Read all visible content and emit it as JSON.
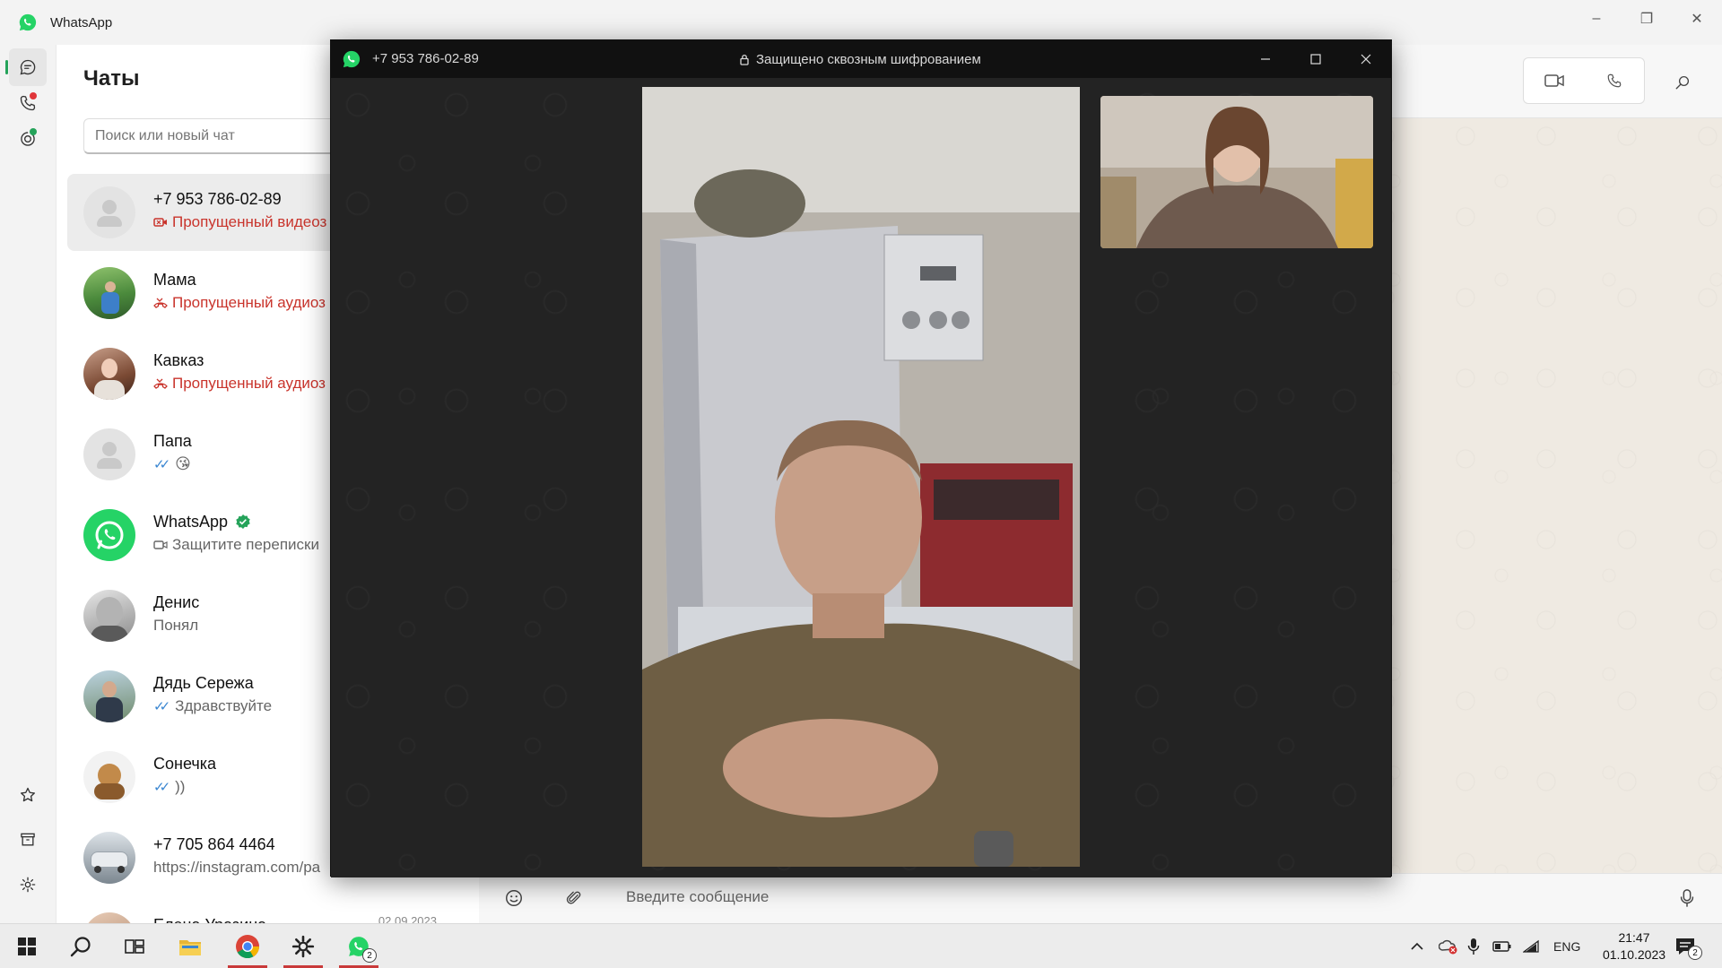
{
  "app": {
    "title": "WhatsApp"
  },
  "chatlist": {
    "title": "Чаты",
    "search_placeholder": "Поиск или новый чат",
    "chats": [
      {
        "name": "+7 953 786-02-89",
        "preview": "Пропущенный видеоз",
        "kind": "missed-video",
        "date": "",
        "avatar": "placeholder"
      },
      {
        "name": "Мама",
        "preview": "Пропущенный аудиоз",
        "kind": "missed-audio",
        "date": "",
        "avatar": "photo-green"
      },
      {
        "name": "Кавказ",
        "preview": "Пропущенный аудиоз",
        "kind": "missed-audio",
        "date": "",
        "avatar": "photo-woman"
      },
      {
        "name": "Папа",
        "preview": "😘",
        "kind": "read",
        "date": "",
        "avatar": "placeholder"
      },
      {
        "name": "WhatsApp",
        "preview": "Защитите переписки",
        "kind": "video",
        "date": "",
        "avatar": "whatsapp",
        "verified": true
      },
      {
        "name": "Денис",
        "preview": "Понял",
        "kind": "plain",
        "date": "",
        "avatar": "photo-child"
      },
      {
        "name": "Дядь Сережа",
        "preview": "Здравствуйте",
        "kind": "read",
        "date": "",
        "avatar": "photo-man"
      },
      {
        "name": "Сонечка",
        "preview": "))",
        "kind": "read",
        "date": "",
        "avatar": "photo-dog"
      },
      {
        "name": "+7 705 864 4464",
        "preview": "https://instagram.com/pa",
        "kind": "plain",
        "date": "",
        "avatar": "photo-car"
      },
      {
        "name": "Елена Уразина",
        "preview": "",
        "kind": "plain",
        "date": "02.09.2023",
        "avatar": "photo-woman2"
      }
    ]
  },
  "composer": {
    "placeholder": "Введите сообщение"
  },
  "call": {
    "number": "+7 953 786-02-89",
    "encryption": "Защищено сквозным шифрованием"
  },
  "taskbar": {
    "language": "ENG",
    "time": "21:47",
    "date": "01.10.2023",
    "whatsapp_badge": "2",
    "notifications_badge": "2"
  },
  "colors": {
    "whatsapp_green": "#25d366",
    "missed_red": "#c9342c",
    "read_blue": "#3a86d1",
    "call_bg": "#222222",
    "call_titlebar": "#111111"
  }
}
